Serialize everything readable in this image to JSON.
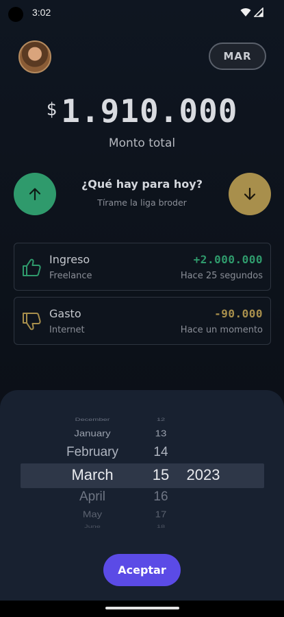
{
  "status_bar": {
    "time": "3:02",
    "icons": [
      "wifi-icon",
      "signal-icon"
    ]
  },
  "header": {
    "avatar": "avatar",
    "month_label": "MAR"
  },
  "balance": {
    "currency": "$",
    "amount": "1.910.000",
    "label": "Monto total"
  },
  "actions": {
    "income_icon": "arrow-up-icon",
    "expense_icon": "arrow-down-icon",
    "title": "¿Qué hay para hoy?",
    "subtitle": "Tírame la liga broder"
  },
  "transactions": [
    {
      "type": "Ingreso",
      "category": "Freelance",
      "amount": "+2.000.000",
      "time": "Hace 25 segundos",
      "icon": "thumbs-up-icon",
      "color": "#2f9a6c"
    },
    {
      "type": "Gasto",
      "category": "Internet",
      "amount": "-90.000",
      "time": "Hace un momento",
      "icon": "thumbs-down-icon",
      "color": "#a88f4c"
    }
  ],
  "date_picker": {
    "months": [
      "December",
      "January",
      "February",
      "March",
      "April",
      "May",
      "June"
    ],
    "days": [
      "12",
      "13",
      "14",
      "15",
      "16",
      "17",
      "18"
    ],
    "year": "2023",
    "selected": {
      "month": "March",
      "day": "15",
      "year": "2023"
    },
    "accept_label": "Aceptar"
  },
  "colors": {
    "accent": "#5b4be6",
    "income": "#2f9a6c",
    "expense": "#a88f4c",
    "background": "#0f1621",
    "sheet": "#182130"
  }
}
